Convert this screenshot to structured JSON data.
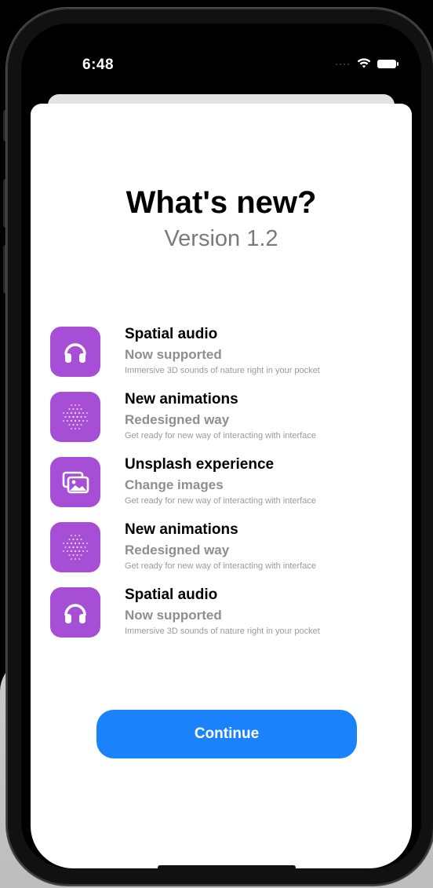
{
  "status_bar": {
    "time": "6:48",
    "signal_icon": "cellular-dots-icon",
    "wifi_icon": "wifi-icon",
    "battery_icon": "battery-icon"
  },
  "header": {
    "title": "What's new?",
    "version": "Version 1.2"
  },
  "features": [
    {
      "icon": "headphones-icon",
      "title": "Spatial audio",
      "subtitle": "Now supported",
      "description": "Immersive 3D sounds of nature right in your pocket"
    },
    {
      "icon": "dot-sphere-icon",
      "title": "New animations",
      "subtitle": "Redesigned way",
      "description": "Get ready for new way of interacting with interface"
    },
    {
      "icon": "photo-stack-icon",
      "title": "Unsplash experience",
      "subtitle": "Change images",
      "description": "Get ready for new way of interacting with interface"
    },
    {
      "icon": "dot-sphere-icon",
      "title": "New animations",
      "subtitle": "Redesigned way",
      "description": "Get ready for new way of interacting with interface"
    },
    {
      "icon": "headphones-icon",
      "title": "Spatial audio",
      "subtitle": "Now supported",
      "description": "Immersive 3D sounds of nature right in your pocket"
    }
  ],
  "continue_button": {
    "label": "Continue"
  },
  "colors": {
    "accent": "#1a82fb",
    "icon_tile": "#a64fd6"
  }
}
